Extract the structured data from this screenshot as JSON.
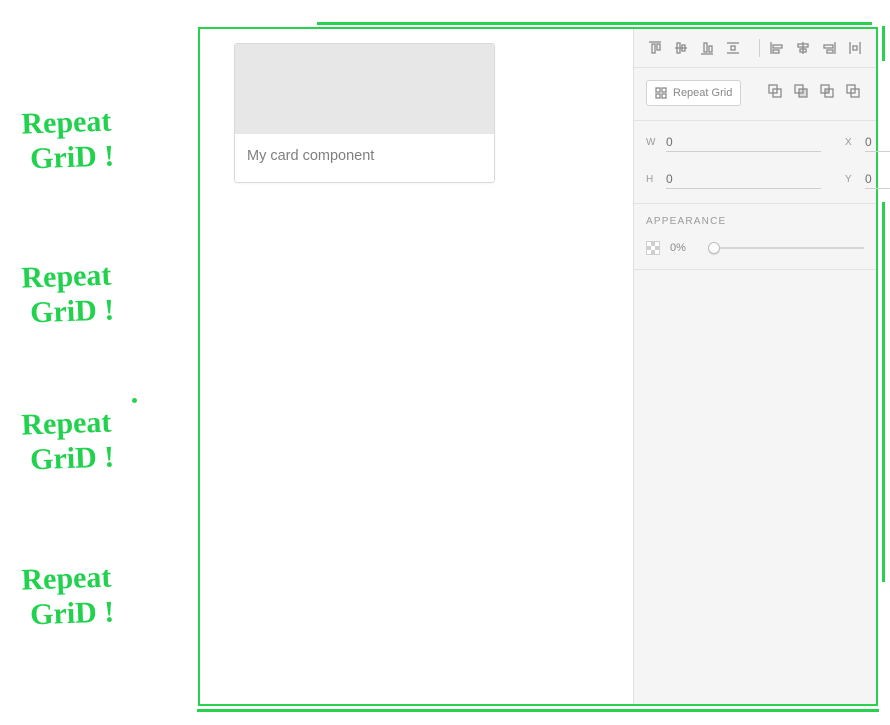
{
  "annotations": {
    "text": "Repeat\n GriD !"
  },
  "canvas": {
    "card": {
      "title": "My card component"
    }
  },
  "panel": {
    "repeat_grid_label": "Repeat Grid",
    "dimensions": {
      "w_label": "W",
      "w_value": "0",
      "h_label": "H",
      "h_value": "0",
      "x_label": "X",
      "x_value": "0",
      "y_label": "Y",
      "y_value": "0"
    },
    "appearance": {
      "section_label": "APPEARANCE",
      "opacity_display": "0%"
    }
  }
}
